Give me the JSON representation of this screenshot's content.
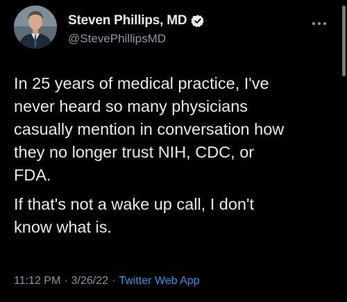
{
  "author": {
    "display_name": "Steven Phillips, MD",
    "handle": "@StevePhillipsMD",
    "verified": true,
    "avatar_icon": "profile-photo"
  },
  "tweet": {
    "paragraphs": [
      "In 25 years of medical practice, I've\nnever heard so many physicians\ncasually mention in conversation how\nthey no longer trust NIH, CDC, or\nFDA.",
      "If that's not a wake up call, I don't\nknow what is."
    ],
    "time": "11:12 PM",
    "date": "3/26/22",
    "separator": "·",
    "source": "Twitter Web App"
  },
  "colors": {
    "background": "#000000",
    "text": "#e7e9ea",
    "muted": "#8b98a5",
    "accent": "#1d9bf0"
  },
  "icons": {
    "verified": "verified-badge-icon",
    "more": "more-options-icon"
  }
}
